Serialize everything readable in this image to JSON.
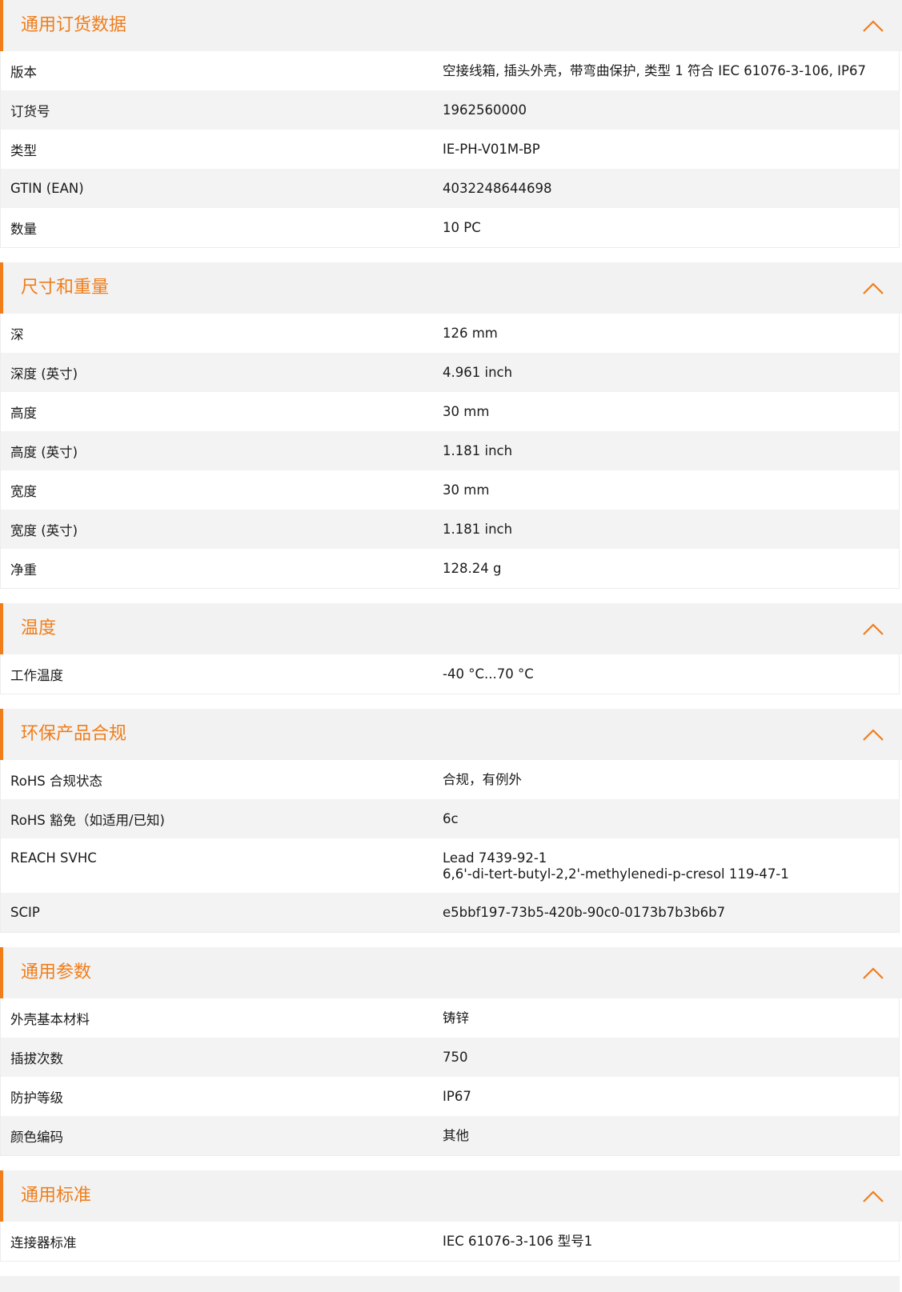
{
  "sections": [
    {
      "title": "通用订货数据",
      "rows": [
        {
          "label": "版本",
          "value": "空接线箱, 插头外壳，带弯曲保护, 类型 1 符合 IEC 61076-3-106, IP67"
        },
        {
          "label": "订货号",
          "value": "1962560000"
        },
        {
          "label": "类型",
          "value": "IE-PH-V01M-BP"
        },
        {
          "label": "GTIN (EAN)",
          "value": "4032248644698"
        },
        {
          "label": "数量",
          "value": "10  PC"
        }
      ]
    },
    {
      "title": "尺寸和重量",
      "rows": [
        {
          "label": "深",
          "value": "126  mm"
        },
        {
          "label": "深度 (英寸)",
          "value": "4.961  inch"
        },
        {
          "label": "高度",
          "value": "30  mm"
        },
        {
          "label": "高度 (英寸)",
          "value": "1.181  inch"
        },
        {
          "label": "宽度",
          "value": "30  mm"
        },
        {
          "label": "宽度 (英寸)",
          "value": "1.181  inch"
        },
        {
          "label": "净重",
          "value": "128.24  g"
        }
      ]
    },
    {
      "title": "温度",
      "rows": [
        {
          "label": "工作温度",
          "value": "-40 °C...70 °C"
        }
      ]
    },
    {
      "title": "环保产品合规",
      "rows": [
        {
          "label": "RoHS 合规状态",
          "value": "合规，有例外"
        },
        {
          "label": "RoHS 豁免（如适用/已知)",
          "value": "6c"
        },
        {
          "label": "REACH SVHC",
          "value": "Lead 7439-92-1\n6,6'-di-tert-butyl-2,2'-methylenedi-p-cresol 119-47-1"
        },
        {
          "label": "SCIP",
          "value": "e5bbf197-73b5-420b-90c0-0173b7b3b6b7"
        }
      ]
    },
    {
      "title": "通用参数",
      "rows": [
        {
          "label": "外壳基本材料",
          "value": "铸锌"
        },
        {
          "label": "插拔次数",
          "value": "750"
        },
        {
          "label": "防护等级",
          "value": "IP67"
        },
        {
          "label": "颜色编码",
          "value": "其他"
        }
      ]
    },
    {
      "title": "通用标准",
      "rows": [
        {
          "label": "连接器标准",
          "value": "IEC 61076-3-106 型号1"
        }
      ]
    }
  ],
  "icons": {
    "collapse": "chevron-up-icon"
  },
  "colors": {
    "accent": "#f07d1a",
    "header_bg": "#f2f2f2",
    "stripe_bg": "#f3f3f3"
  }
}
